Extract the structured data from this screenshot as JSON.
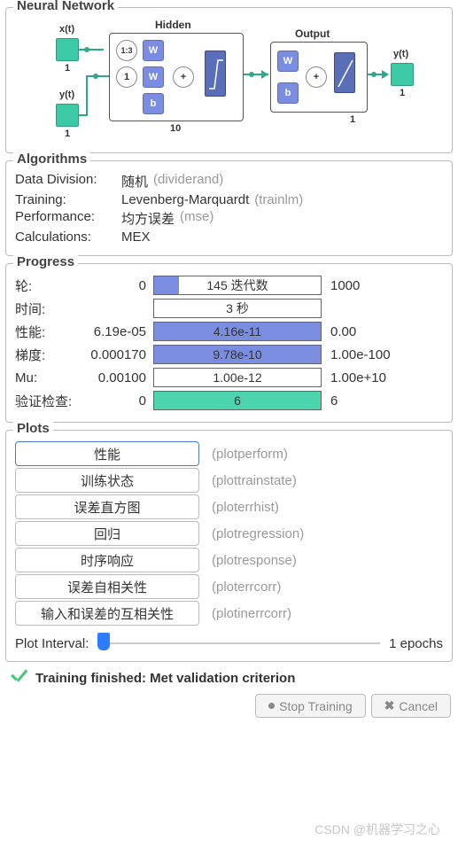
{
  "sections": {
    "network_title": "Neural Network",
    "algorithms_title": "Algorithms",
    "progress_title": "Progress",
    "plots_title": "Plots"
  },
  "diagram": {
    "input1": "x(t)",
    "input1_num": "1",
    "input2": "y(t)",
    "input2_num": "1",
    "hidden_label": "Hidden",
    "hidden_delay": "1:3",
    "hidden_delay2": "1",
    "hidden_w1": "W",
    "hidden_w2": "W",
    "hidden_b": "b",
    "hidden_sum": "+",
    "hidden_count": "10",
    "output_label": "Output",
    "output_w": "W",
    "output_b": "b",
    "output_sum": "+",
    "output_count": "1",
    "out_label": "y(t)",
    "out_num": "1"
  },
  "algorithms": [
    {
      "label": "Data Division:",
      "value": "随机",
      "tag": "(dividerand)"
    },
    {
      "label": "Training:",
      "value": "Levenberg-Marquardt",
      "tag": "(trainlm)"
    },
    {
      "label": "Performance:",
      "value": "均方误差",
      "tag": "(mse)"
    },
    {
      "label": "Calculations:",
      "value": "MEX",
      "tag": ""
    }
  ],
  "progress": [
    {
      "name": "轮:",
      "min": "0",
      "text": "145 迭代数",
      "max": "1000",
      "fill_pct": 15,
      "color": "blue"
    },
    {
      "name": "时间:",
      "min": "",
      "text": "3 秒",
      "max": "",
      "fill_pct": 0,
      "color": "none"
    },
    {
      "name": "性能:",
      "min": "6.19e-05",
      "text": "4.16e-11",
      "max": "0.00",
      "fill_pct": 100,
      "color": "blue"
    },
    {
      "name": "梯度:",
      "min": "0.000170",
      "text": "9.78e-10",
      "max": "1.00e-100",
      "fill_pct": 100,
      "color": "blue"
    },
    {
      "name": "Mu:",
      "min": "0.00100",
      "text": "1.00e-12",
      "max": "1.00e+10",
      "fill_pct": 0,
      "color": "none"
    },
    {
      "name": "验证检查:",
      "min": "0",
      "text": "6",
      "max": "6",
      "fill_pct": 100,
      "color": "green"
    }
  ],
  "plots": [
    {
      "label": "性能",
      "tag": "(plotperform)",
      "primary": true
    },
    {
      "label": "训练状态",
      "tag": "(plottrainstate)",
      "primary": false
    },
    {
      "label": "误差直方图",
      "tag": "(ploterrhist)",
      "primary": false
    },
    {
      "label": "回归",
      "tag": "(plotregression)",
      "primary": false
    },
    {
      "label": "时序响应",
      "tag": "(plotresponse)",
      "primary": false
    },
    {
      "label": "误差自相关性",
      "tag": "(ploterrcorr)",
      "primary": false
    },
    {
      "label": "输入和误差的互相关性",
      "tag": "(plotinerrcorr)",
      "primary": false
    }
  ],
  "plot_interval": {
    "label": "Plot Interval:",
    "value": "1 epochs"
  },
  "status": "Training finished: Met validation criterion",
  "buttons": {
    "stop": "Stop Training",
    "cancel": "Cancel"
  },
  "watermark": "CSDN @机器学习之心"
}
